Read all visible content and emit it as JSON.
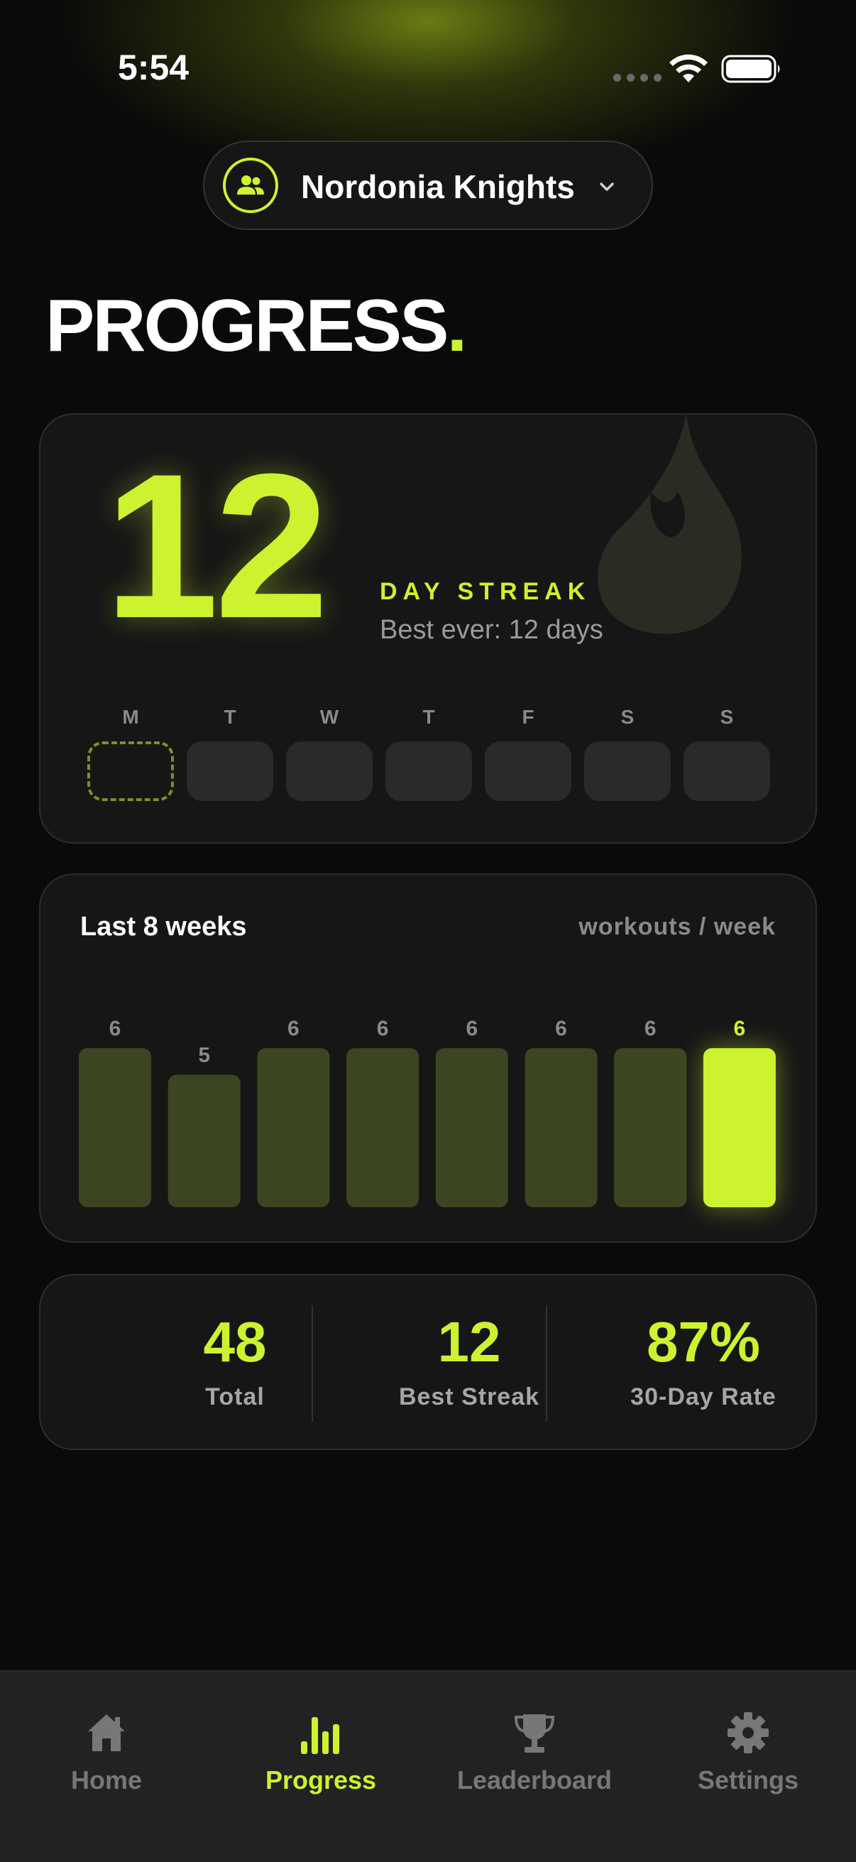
{
  "status_bar": {
    "time": "5:54"
  },
  "team": {
    "name": "Nordonia Knights"
  },
  "page": {
    "title": "PROGRESS",
    "title_dot": "."
  },
  "streak": {
    "count": "12",
    "label": "DAY STREAK",
    "best": "Best ever: 12 days",
    "days": [
      {
        "letter": "M",
        "state": "today"
      },
      {
        "letter": "T",
        "state": "empty"
      },
      {
        "letter": "W",
        "state": "empty"
      },
      {
        "letter": "T",
        "state": "empty"
      },
      {
        "letter": "F",
        "state": "empty"
      },
      {
        "letter": "S",
        "state": "empty"
      },
      {
        "letter": "S",
        "state": "empty"
      }
    ]
  },
  "weeks": {
    "title": "Last 8 weeks",
    "unit": "workouts / week"
  },
  "chart_data": {
    "type": "bar",
    "categories": [
      "",
      "",
      "",
      "",
      "",
      "",
      "",
      ""
    ],
    "values": [
      6,
      5,
      6,
      6,
      6,
      6,
      6,
      6
    ],
    "highlight_index": 7,
    "ylim": [
      0,
      6
    ],
    "title": "Last 8 weeks",
    "ylabel": "workouts / week",
    "colors": {
      "bar": "#3b4520",
      "highlight": "#cdf22f",
      "label": "#8a8a8a"
    }
  },
  "stats": [
    {
      "value": "48",
      "label": "Total"
    },
    {
      "value": "12",
      "label": "Best Streak"
    },
    {
      "value": "87%",
      "label": "30-Day Rate"
    }
  ],
  "tabs": [
    {
      "label": "Home",
      "icon": "home-icon",
      "active": false
    },
    {
      "label": "Progress",
      "icon": "bar-chart-icon",
      "active": true
    },
    {
      "label": "Leaderboard",
      "icon": "trophy-icon",
      "active": false
    },
    {
      "label": "Settings",
      "icon": "gear-icon",
      "active": false
    }
  ],
  "colors": {
    "accent": "#cdf22f",
    "background": "#0a0a0a",
    "card": "#161616"
  }
}
